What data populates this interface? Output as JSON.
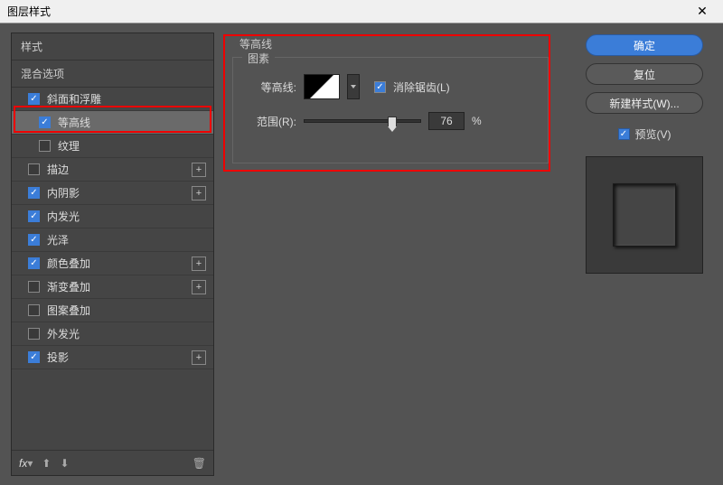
{
  "title": "图层样式",
  "left": {
    "header": "样式",
    "blend": "混合选项",
    "items": [
      {
        "label": "斜面和浮雕",
        "checked": true,
        "selected": false,
        "add": false,
        "sub": false
      },
      {
        "label": "等高线",
        "checked": true,
        "selected": true,
        "add": false,
        "sub": true
      },
      {
        "label": "纹理",
        "checked": false,
        "selected": false,
        "add": false,
        "sub": true
      },
      {
        "label": "描边",
        "checked": false,
        "selected": false,
        "add": true,
        "sub": false
      },
      {
        "label": "内阴影",
        "checked": true,
        "selected": false,
        "add": true,
        "sub": false
      },
      {
        "label": "内发光",
        "checked": true,
        "selected": false,
        "add": false,
        "sub": false
      },
      {
        "label": "光泽",
        "checked": true,
        "selected": false,
        "add": false,
        "sub": false
      },
      {
        "label": "颜色叠加",
        "checked": true,
        "selected": false,
        "add": true,
        "sub": false
      },
      {
        "label": "渐变叠加",
        "checked": false,
        "selected": false,
        "add": true,
        "sub": false
      },
      {
        "label": "图案叠加",
        "checked": false,
        "selected": false,
        "add": false,
        "sub": false
      },
      {
        "label": "外发光",
        "checked": false,
        "selected": false,
        "add": false,
        "sub": false
      },
      {
        "label": "投影",
        "checked": true,
        "selected": false,
        "add": true,
        "sub": false
      }
    ],
    "footer": {
      "fx": "fx",
      "trash": "🗑"
    }
  },
  "center": {
    "section_title": "等高线",
    "fieldset_legend": "图素",
    "contour_label": "等高线:",
    "antialias_label": "消除锯齿(L)",
    "antialias_checked": true,
    "range_label": "范围(R):",
    "range_value": "76",
    "range_unit": "%"
  },
  "right": {
    "ok": "确定",
    "reset": "复位",
    "new_style": "新建样式(W)...",
    "preview": "预览(V)",
    "preview_checked": true
  }
}
